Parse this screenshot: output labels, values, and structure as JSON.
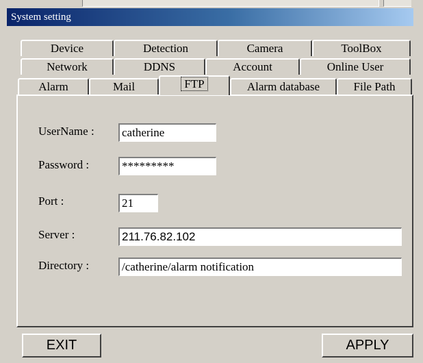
{
  "window": {
    "title": "System setting"
  },
  "tabs": {
    "row1": [
      "Device",
      "Detection",
      "Camera",
      "ToolBox"
    ],
    "row2": [
      "Network",
      "DDNS",
      "Account",
      "Online User"
    ],
    "row3": [
      "Alarm",
      "Mail",
      "FTP",
      "Alarm database",
      "File Path"
    ],
    "selected": "FTP"
  },
  "ftp": {
    "username_label": "UserName :",
    "username_value": "catherine",
    "password_label": "Password :",
    "password_value": "*********",
    "port_label": "Port :",
    "port_value": "21",
    "server_label": "Server  :",
    "server_value": "211.76.82.102",
    "directory_label": "Directory :",
    "directory_value": "/catherine/alarm notification"
  },
  "buttons": {
    "exit": "EXIT",
    "apply": "APPLY"
  }
}
